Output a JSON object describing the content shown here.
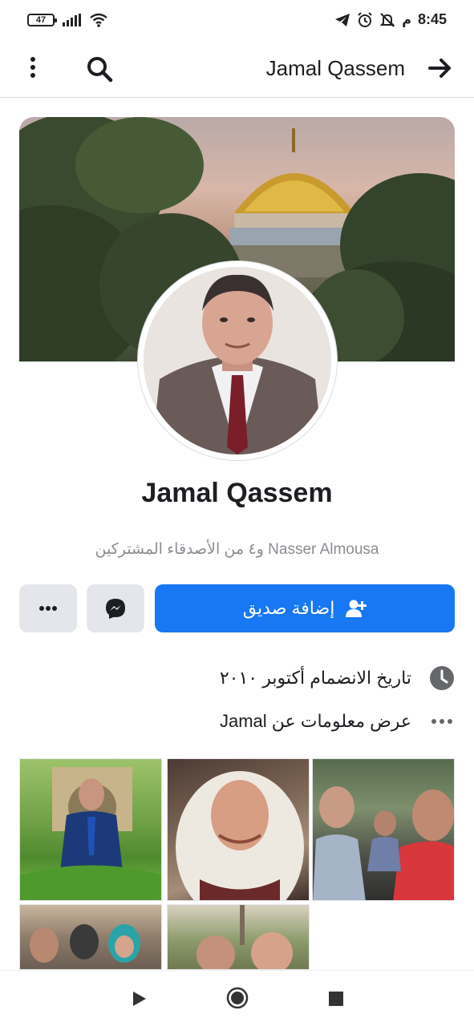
{
  "status_bar": {
    "battery": "47",
    "time": "8:45",
    "ampm": "م"
  },
  "nav": {
    "title": "Jamal Qassem",
    "icons": [
      "more-vertical-icon",
      "search-icon",
      "arrow-right-icon"
    ]
  },
  "profile": {
    "name": "Jamal Qassem",
    "mutual_friend_name": "Nasser Almousa",
    "mutual_friends_suffix": "و٤ من الأصدقاء المشتركين"
  },
  "actions": {
    "add_friend_label": "إضافة صديق",
    "icons": [
      "more-horizontal-icon",
      "messenger-icon",
      "add-person-icon"
    ]
  },
  "info": {
    "joined": "تاريخ الانضمام أكتوبر ٢٠١٠",
    "about": "عرض معلومات عن Jamal"
  },
  "photos": {
    "count_visible": 5
  },
  "colors": {
    "accent": "#1877f2",
    "button_gray": "#e4e6eb",
    "muted_text": "#8a8d91"
  }
}
